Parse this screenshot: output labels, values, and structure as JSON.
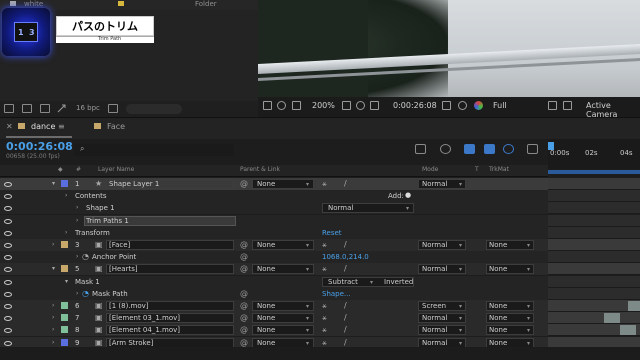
{
  "project": {
    "name_col": "white",
    "folder_col": "Folder",
    "bpc": "16 bpc",
    "title_overlay": "パスのトリム",
    "subtitle_overlay": "Trim Path",
    "logo_glyphs": [
      "1",
      "3"
    ]
  },
  "viewer": {
    "zoom": "200%",
    "time": "0:00:26:08",
    "resolution": "Full",
    "camera": "Active Camera"
  },
  "tabs": [
    {
      "label": "dance",
      "menu": "≡",
      "color": "#c7a86a"
    },
    {
      "label": "Face",
      "color": "#c7a86a"
    }
  ],
  "timeline": {
    "timecode": "0:00:26:08",
    "frames": "00658 (25.00 fps)",
    "search_icon": "search-icon",
    "ruler_ticks": [
      "0:00s",
      "02s",
      "04s"
    ],
    "columns": {
      "num": "#",
      "layer_name": "Layer Name",
      "parent": "Parent & Link",
      "mode": "Mode",
      "t": "T",
      "trkmat": "TrkMat"
    }
  },
  "layers": [
    {
      "kind": "layer",
      "num": "1",
      "name": "Shape Layer 1",
      "color": "#5b6ee0",
      "parent": "None",
      "mode": "Normal",
      "trkmat": "",
      "selected": true
    },
    {
      "kind": "group",
      "name": "Contents",
      "extra": "Add:",
      "indent": 1
    },
    {
      "kind": "group",
      "name": "Shape 1",
      "mode": "Normal",
      "indent": 2
    },
    {
      "kind": "group",
      "name": "Trim Paths 1",
      "indent": 2,
      "highlight": true
    },
    {
      "kind": "group",
      "name": "Transform",
      "value": "Reset",
      "indent": 1
    },
    {
      "kind": "layer",
      "num": "3",
      "name": "[Face]",
      "color": "#c7a86a",
      "parent": "None",
      "mode": "Normal",
      "trkmat": "None"
    },
    {
      "kind": "prop",
      "name": "Anchor Point",
      "value": "1068.0,214.0",
      "indent": 2
    },
    {
      "kind": "layer",
      "num": "5",
      "name": "[Hearts]",
      "color": "#c7a86a",
      "parent": "None",
      "mode": "Normal",
      "trkmat": "None"
    },
    {
      "kind": "mask",
      "name": "Mask 1",
      "mode": "Subtract",
      "extra": "Inverted",
      "indent": 1
    },
    {
      "kind": "prop",
      "name": "Mask Path",
      "value": "Shape...",
      "indent": 2
    },
    {
      "kind": "layer",
      "num": "6",
      "name": "[1 (8).mov]",
      "color": "#7fbf9a",
      "parent": "None",
      "mode": "Screen",
      "trkmat": "None"
    },
    {
      "kind": "layer",
      "num": "7",
      "name": "[Element 03_1.mov]",
      "color": "#7fbf9a",
      "parent": "None",
      "mode": "Normal",
      "trkmat": "None"
    },
    {
      "kind": "layer",
      "num": "8",
      "name": "[Element 04_1.mov]",
      "color": "#7fbf9a",
      "parent": "None",
      "mode": "Normal",
      "trkmat": "None"
    },
    {
      "kind": "layer",
      "num": "9",
      "name": "[Arm Stroke]",
      "color": "#5b6ee0",
      "parent": "None",
      "mode": "Normal",
      "trkmat": "None"
    }
  ]
}
